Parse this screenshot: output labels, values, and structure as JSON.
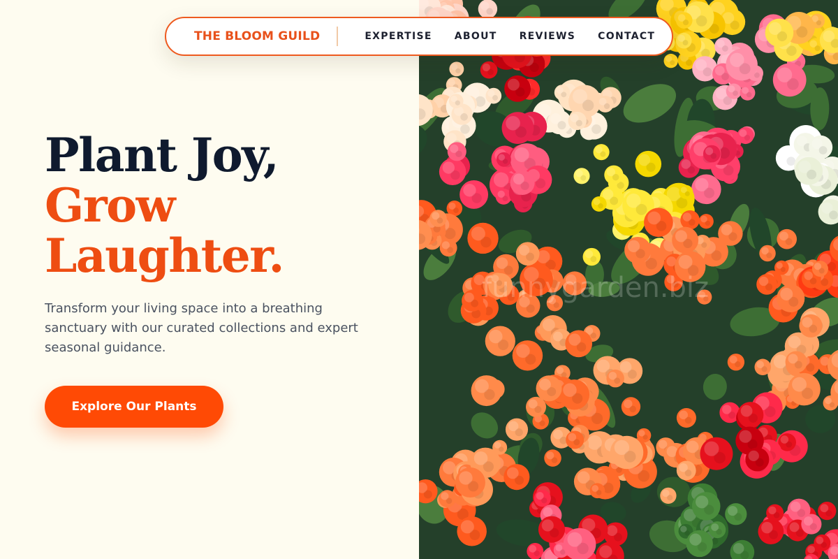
{
  "nav": {
    "brand": "THE BLOOM GUILD",
    "links": [
      "EXPERTISE",
      "ABOUT",
      "REVIEWS",
      "CONTACT"
    ]
  },
  "hero": {
    "headline_line1": "Plant Joy,",
    "headline_line2": "Grow",
    "headline_line3": "Laughter.",
    "subtext": "Transform your living space into a breathing sanctuary with our curated collections and expert seasonal guidance.",
    "cta_label": "Explore Our Plants"
  },
  "colors": {
    "background": "#fefcf0",
    "accent": "#ff4a05",
    "headline_dark": "#0f1a2e",
    "brand_orange": "#e8511b"
  },
  "photo": {
    "subject": "begonia-flowers",
    "watermark": "funnygarden.biz"
  }
}
